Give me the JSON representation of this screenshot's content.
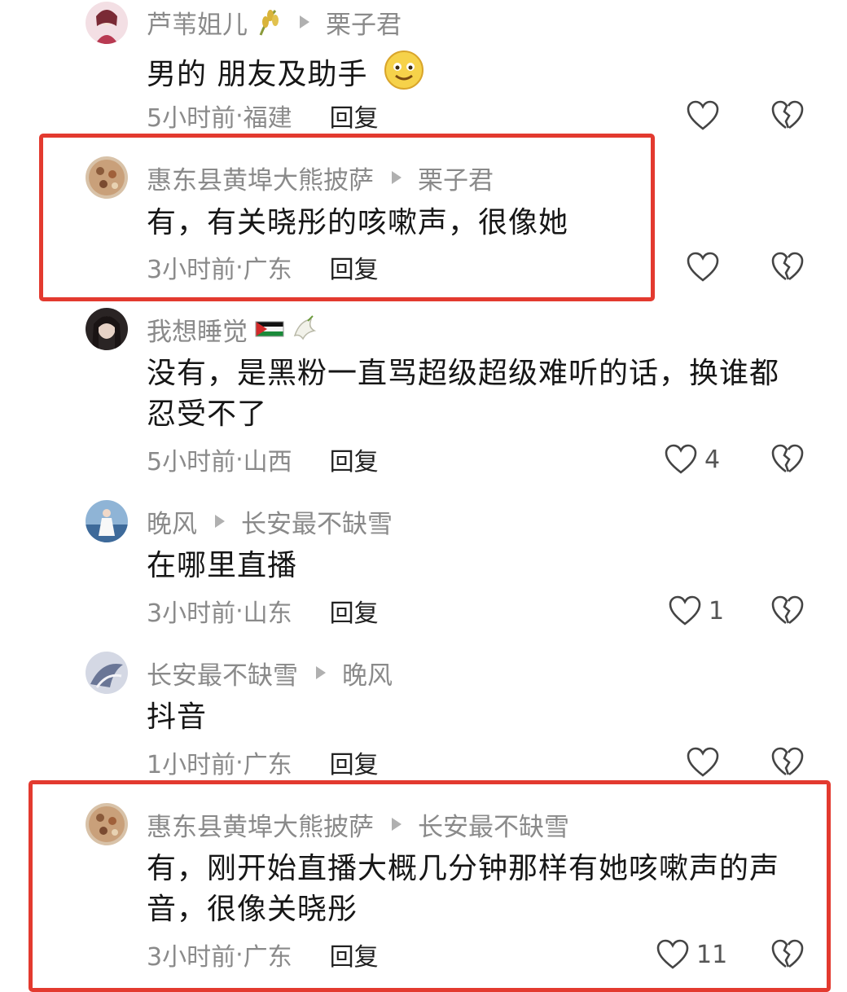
{
  "comments": [
    {
      "author": "芦苇姐儿",
      "author_emoji": "wheat-icon",
      "reply_to": "栗子君",
      "text": "男的 朋友及助手",
      "text_emoji": "smile-icon",
      "time": "5小时前",
      "location": "福建",
      "reply_label": "回复",
      "likes": ""
    },
    {
      "author": "惠东县黄埠大熊披萨",
      "reply_to": "栗子君",
      "text": "有，有关晓彤的咳嗽声，很像她",
      "time": "3小时前",
      "location": "广东",
      "reply_label": "回复",
      "likes": ""
    },
    {
      "author": "我想睡觉",
      "author_emoji": "palestine-flag-and-dove-icon",
      "text": "没有，是黑粉一直骂超级超级难听的话，换谁都忍受不了",
      "time": "5小时前",
      "location": "山西",
      "reply_label": "回复",
      "likes": "4"
    },
    {
      "author": "晚风",
      "reply_to": "长安最不缺雪",
      "text": "在哪里直播",
      "time": "3小时前",
      "location": "山东",
      "reply_label": "回复",
      "likes": "1"
    },
    {
      "author": "长安最不缺雪",
      "reply_to": "晚风",
      "text": "抖音",
      "time": "1小时前",
      "location": "广东",
      "reply_label": "回复",
      "likes": ""
    },
    {
      "author": "惠东县黄埠大熊披萨",
      "reply_to": "长安最不缺雪",
      "text": "有，刚开始直播大概几分钟那样有她咳嗽声的声音，很像关晓彤",
      "time": "3小时前",
      "location": "广东",
      "reply_label": "回复",
      "likes": "11"
    }
  ],
  "separator": " · ",
  "colors": {
    "highlight": "#e33a2f",
    "meta": "#8a8a8a"
  }
}
